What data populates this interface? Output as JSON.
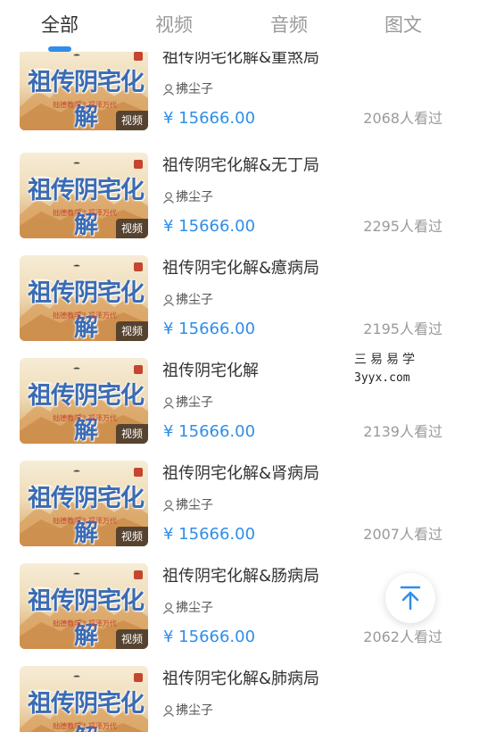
{
  "tabs": [
    {
      "label": "全部",
      "active": true
    },
    {
      "label": "视频",
      "active": false
    },
    {
      "label": "音频",
      "active": false
    },
    {
      "label": "图文",
      "active": false
    }
  ],
  "thumbnail": {
    "title": "祖传阴宅化解",
    "subtitle": "拙德教学 | 福泽万代"
  },
  "items": [
    {
      "title": "祖传阴宅化解&重煞局",
      "author": "拂尘子",
      "price": "¥ 15666.00",
      "views": "2068人看过",
      "badge": "视频"
    },
    {
      "title": "祖传阴宅化解&无丁局",
      "author": "拂尘子",
      "price": "¥ 15666.00",
      "views": "2295人看过",
      "badge": "视频"
    },
    {
      "title": "祖传阴宅化解&癔病局",
      "author": "拂尘子",
      "price": "¥ 15666.00",
      "views": "2195人看过",
      "badge": "视频"
    },
    {
      "title": "祖传阴宅化解",
      "author": "拂尘子",
      "price": "¥ 15666.00",
      "views": "2139人看过",
      "badge": "视频"
    },
    {
      "title": "祖传阴宅化解&肾病局",
      "author": "拂尘子",
      "price": "¥ 15666.00",
      "views": "2007人看过",
      "badge": "视频"
    },
    {
      "title": "祖传阴宅化解&肠病局",
      "author": "拂尘子",
      "price": "¥ 15666.00",
      "views": "2062人看过",
      "badge": "视频"
    },
    {
      "title": "祖传阴宅化解&肺病局",
      "author": "拂尘子",
      "price": "",
      "views": "",
      "badge": ""
    }
  ],
  "watermark": {
    "name": "三易易学",
    "url": "3yyx.com"
  },
  "colors": {
    "accent": "#2f8ee9",
    "text": "#333333",
    "muted": "#9a9a9a"
  },
  "icons": {
    "author": "user-icon",
    "back_to_top": "arrow-up-icon"
  }
}
